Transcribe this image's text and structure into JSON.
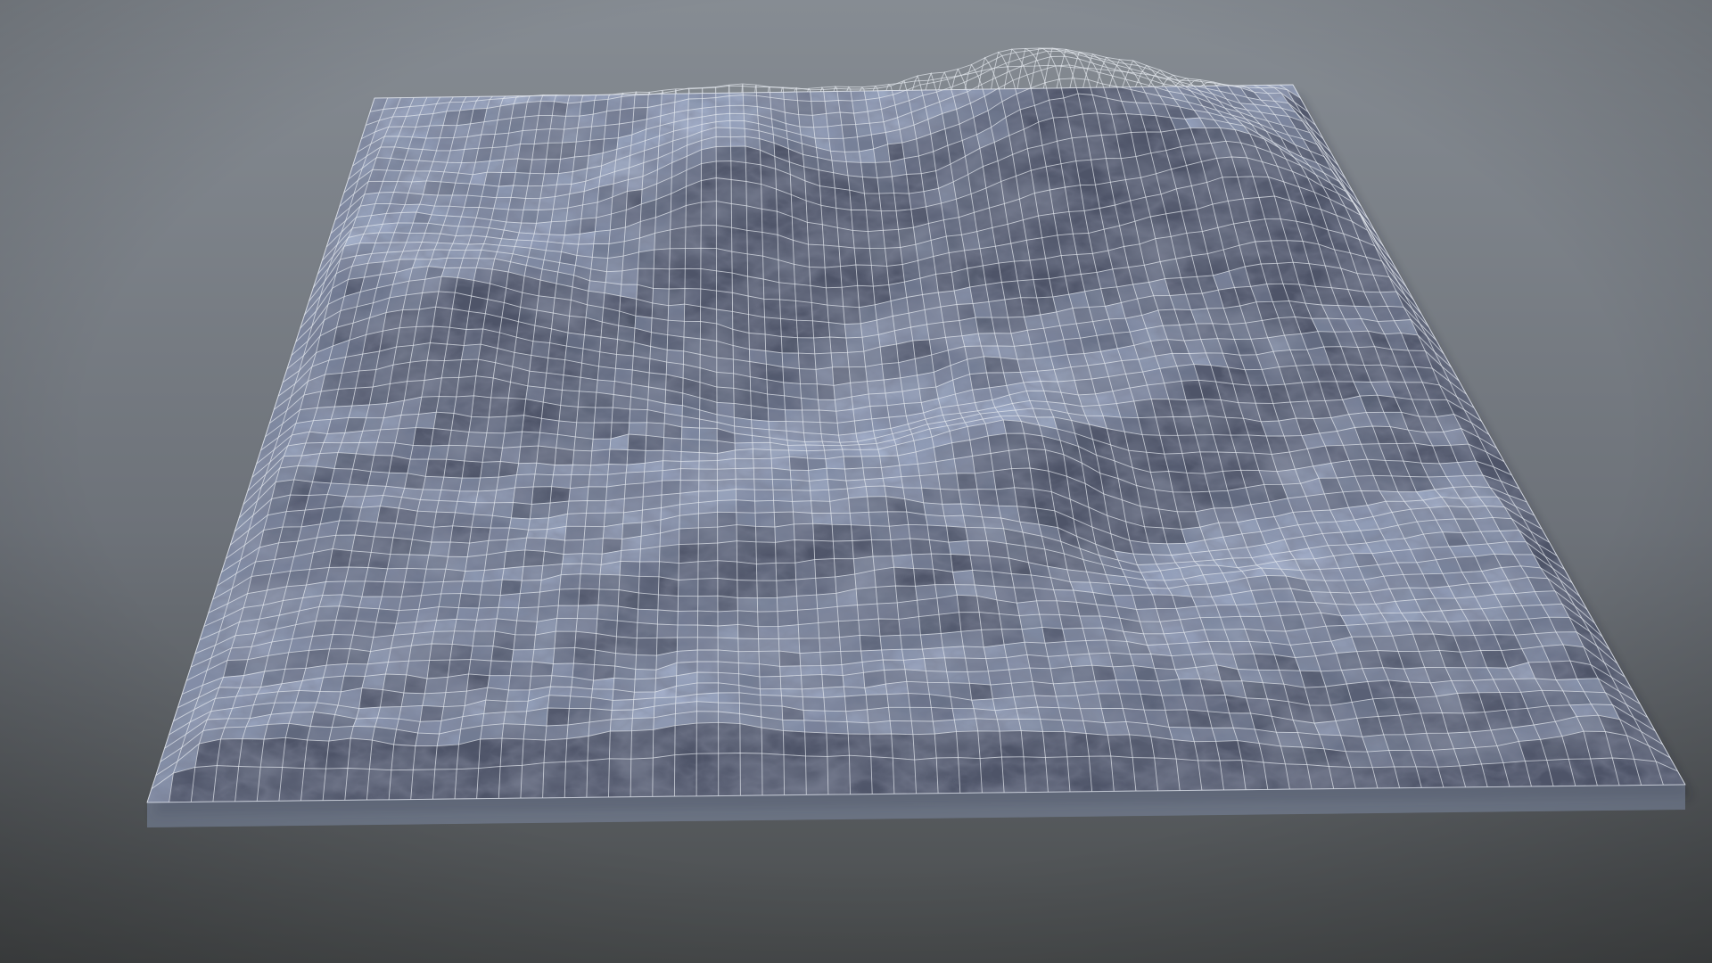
{
  "scene": {
    "subject": "terrain-mesh-wireframe",
    "background_top_color": "#868c93",
    "background_bottom_color": "#494c4d",
    "rock_light_color": "#8e9ab0",
    "rock_mid_color": "#67718a",
    "rock_dark_color": "#3e4356",
    "wire_color": "#e6eaf0"
  }
}
